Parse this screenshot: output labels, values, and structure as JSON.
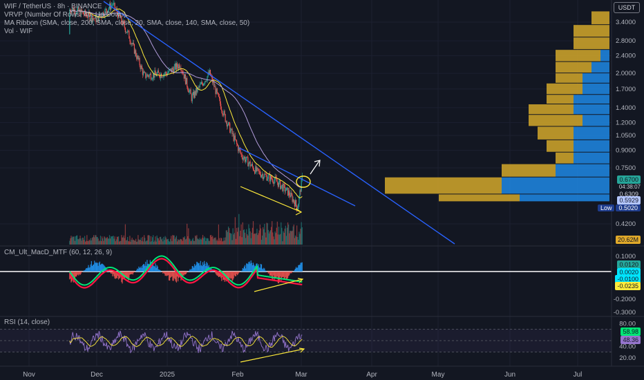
{
  "legend": {
    "title": "WIF / TetherUS · 8h · BINANCE",
    "vrvp": "VRVP (Number Of Rows, 40, Up/Down)",
    "ma_ribbon": "MA Ribbon (SMA, close, 200, SMA, close, 20, SMA, close, 140, SMA, close, 50)",
    "volume": "Vol · WIF",
    "macd": "CM_Ult_MacD_MTF (60, 12, 26, 9)",
    "rsi": "RSI (14, close)"
  },
  "price_axis_unit": "USDT",
  "price_tags": [
    {
      "text": "0.6700",
      "color": "#26a69a"
    },
    {
      "text": "04:38:07",
      "color": "#131722"
    },
    {
      "text": "0.6309",
      "color": "#b3c6ff"
    },
    {
      "text": "0.5929",
      "color": "#e0a92a"
    }
  ],
  "low_tag": {
    "label": "Low",
    "price": "0.5020"
  },
  "volume_tag": {
    "text": "20.62M",
    "color": "#26a69a"
  },
  "macd_tags": [
    {
      "text": "0.0120",
      "color": "#00e5ff"
    },
    {
      "text": "0.0020",
      "color": "#00e5ff"
    },
    {
      "text": "-0.0100",
      "color": "#ffeb3b"
    },
    {
      "text": "-0.0235",
      "color": "#00e676"
    }
  ],
  "rsi_tags": [
    {
      "text": "58.98",
      "color": "#9575cd"
    },
    {
      "text": "48.36",
      "color": "#ffeb3b"
    }
  ],
  "colors": {
    "background": "#131722",
    "up_candle": "#26a69a",
    "down_candle": "#ef5350",
    "trendline": "#2962ff",
    "annotation": "#ffeb3b",
    "vrvp_up": "#1e88e5",
    "vrvp_down": "#d4a82a"
  },
  "chart_data": [
    {
      "type": "candlestick",
      "title": "WIF / TetherUS · 8h · BINANCE",
      "x_ticks": [
        "Nov",
        "Dec",
        "2025",
        "Feb",
        "Mar",
        "Apr",
        "May",
        "Jun",
        "Jul"
      ],
      "y_ticks": [
        "3.4000",
        "2.8000",
        "2.4000",
        "2.0000",
        "1.7000",
        "1.4000",
        "1.2000",
        "1.0500",
        "0.9000",
        "0.7500",
        "0.4200"
      ],
      "y_scale": "log",
      "price_path": [
        {
          "x": "Oct 25",
          "y": 3.0
        },
        {
          "x": "Nov 05",
          "y": 2.2
        },
        {
          "x": "Nov 12",
          "y": 3.6
        },
        {
          "x": "Nov 20",
          "y": 3.9
        },
        {
          "x": "Dec 01",
          "y": 3.5
        },
        {
          "x": "Dec 08",
          "y": 4.1
        },
        {
          "x": "Dec 15",
          "y": 3.0
        },
        {
          "x": "Dec 22",
          "y": 1.95
        },
        {
          "x": "Jan 01",
          "y": 2.0
        },
        {
          "x": "Jan 07",
          "y": 2.2
        },
        {
          "x": "Jan 12",
          "y": 1.55
        },
        {
          "x": "Jan 20",
          "y": 2.0
        },
        {
          "x": "Jan 27",
          "y": 1.25
        },
        {
          "x": "Feb 03",
          "y": 0.86
        },
        {
          "x": "Feb 10",
          "y": 0.72
        },
        {
          "x": "Feb 18",
          "y": 0.66
        },
        {
          "x": "Feb 24",
          "y": 0.58
        },
        {
          "x": "Feb 28",
          "y": 0.5
        },
        {
          "x": "Mar 02",
          "y": 0.67
        }
      ],
      "series": [
        {
          "name": "SMA 20",
          "color": "#ffeb3b"
        },
        {
          "name": "SMA 50",
          "color": "#b39ddb"
        }
      ],
      "vrvp_profile": [
        {
          "price": 3.8,
          "up": 0.0,
          "down": 0.1
        },
        {
          "price": 3.3,
          "up": 0.0,
          "down": 0.2
        },
        {
          "price": 2.9,
          "up": 0.0,
          "down": 0.2
        },
        {
          "price": 2.55,
          "up": 0.05,
          "down": 0.25
        },
        {
          "price": 2.25,
          "up": 0.1,
          "down": 0.2
        },
        {
          "price": 2.0,
          "up": 0.15,
          "down": 0.15
        },
        {
          "price": 1.8,
          "up": 0.15,
          "down": 0.2
        },
        {
          "price": 1.6,
          "up": 0.2,
          "down": 0.15
        },
        {
          "price": 1.45,
          "up": 0.2,
          "down": 0.25
        },
        {
          "price": 1.3,
          "up": 0.15,
          "down": 0.3
        },
        {
          "price": 1.15,
          "up": 0.2,
          "down": 0.2
        },
        {
          "price": 1.0,
          "up": 0.2,
          "down": 0.15
        },
        {
          "price": 0.88,
          "up": 0.2,
          "down": 0.1
        },
        {
          "price": 0.78,
          "up": 0.3,
          "down": 0.3
        },
        {
          "price": 0.68,
          "up": 0.6,
          "down": 0.65
        },
        {
          "price": 0.57,
          "up": 0.5,
          "down": 0.45
        }
      ]
    },
    {
      "type": "bar",
      "title": "Vol · WIF",
      "value_label": "20.62M"
    },
    {
      "type": "line",
      "title": "CM_Ult_MacD_MTF (60, 12, 26, 9)",
      "y_ticks": [
        "0.1000",
        "-0.2000",
        "-0.3000"
      ],
      "series": [
        {
          "name": "MACD",
          "color": "#00e676"
        },
        {
          "name": "Signal",
          "color": "#ff1744"
        }
      ],
      "last_values": [
        0.012,
        0.002,
        -0.01,
        -0.0235
      ]
    },
    {
      "type": "line",
      "title": "RSI (14, close)",
      "y_ticks": [
        "80.00",
        "40.00",
        "20.00"
      ],
      "ylim": [
        10,
        90
      ],
      "series": [
        {
          "name": "RSI",
          "color": "#9575cd"
        },
        {
          "name": "RSI MA",
          "color": "#ffeb3b"
        }
      ],
      "last_values": [
        58.98,
        48.36
      ]
    }
  ]
}
